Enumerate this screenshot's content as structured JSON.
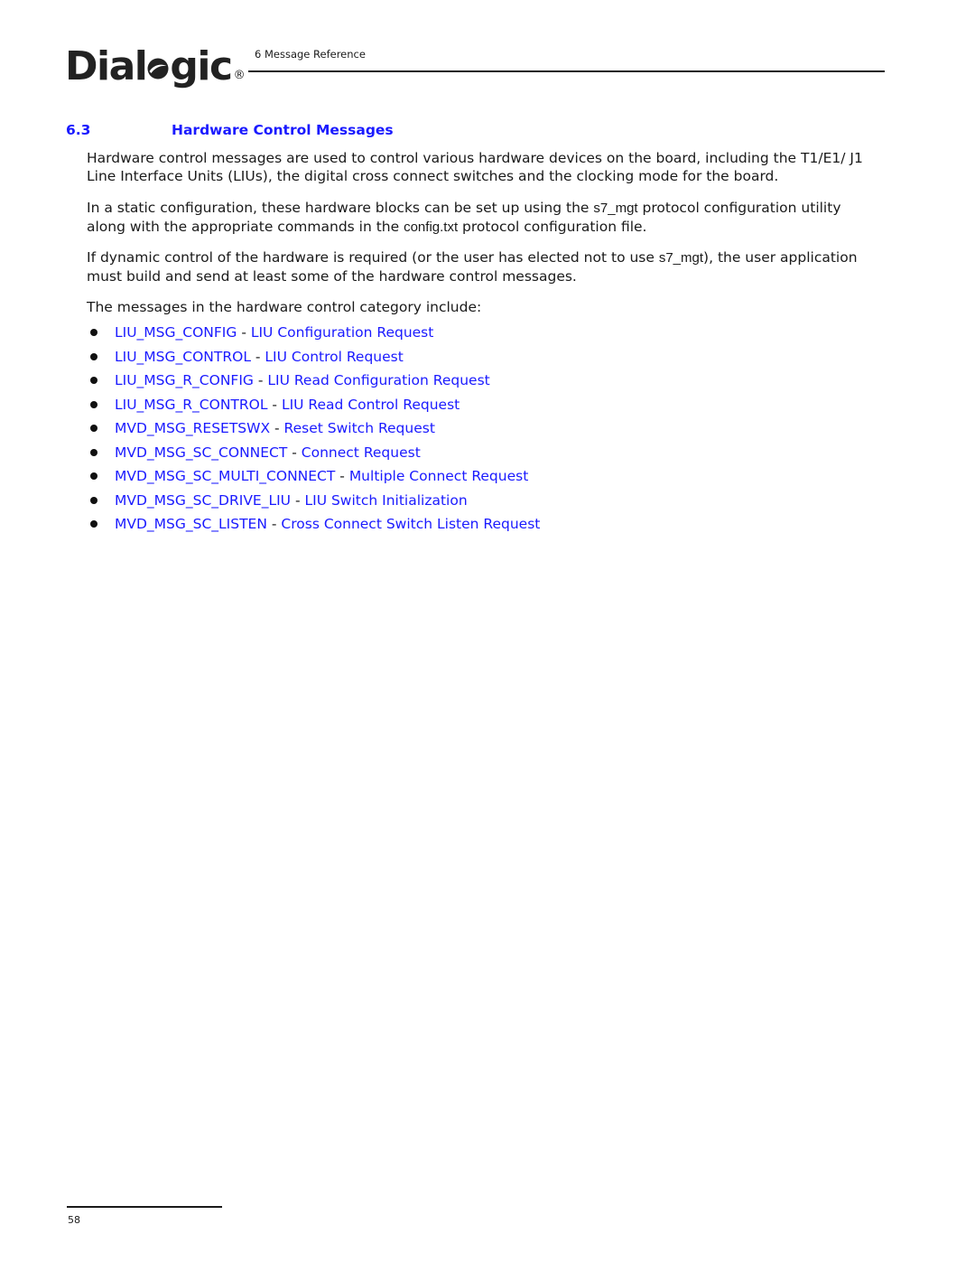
{
  "header": {
    "logo": {
      "text_before_o": "Dial",
      "text_after_o": "gic",
      "registered_mark": "®",
      "brand_color": "#222222"
    },
    "chapter_title": "6 Message Reference"
  },
  "section": {
    "number": "6.3",
    "title": "Hardware Control Messages",
    "heading_color": "#1a1aff"
  },
  "paragraphs": {
    "p1": "Hardware control messages are used to control various hardware devices on the board, including the T1/E1/ J1 Line Interface Units (LIUs), the digital cross connect switches and the clocking mode for the board.",
    "p2": {
      "part1": "In a static configuration, these hardware blocks can be set up using the ",
      "code1": "s7_mgt",
      "part2": " protocol configuration utility along with the appropriate commands in the ",
      "code2": "config.txt",
      "part3": " protocol configuration file."
    },
    "p3": {
      "part1": "If dynamic control of the hardware is required (or the user has elected not to use ",
      "code1": "s7_mgt",
      "part2": "), the user application must build and send at least some of the hardware control messages."
    },
    "p4": "The messages in the hardware control category include:"
  },
  "messages": [
    {
      "name": "LIU_MSG_CONFIG",
      "separator": " - ",
      "description": "LIU Configuration Request"
    },
    {
      "name": "LIU_MSG_CONTROL",
      "separator": " - ",
      "description": "LIU Control Request"
    },
    {
      "name": "LIU_MSG_R_CONFIG",
      "separator": " - ",
      "description": "LIU Read Configuration Request"
    },
    {
      "name": "LIU_MSG_R_CONTROL",
      "separator": " - ",
      "description": "LIU Read Control Request"
    },
    {
      "name": "MVD_MSG_RESETSWX",
      "separator": " - ",
      "description": "Reset Switch Request"
    },
    {
      "name": "MVD_MSG_SC_CONNECT",
      "separator": " - ",
      "description": "Connect Request"
    },
    {
      "name": "MVD_MSG_SC_MULTI_CONNECT",
      "separator": " - ",
      "description": "Multiple Connect Request"
    },
    {
      "name": "MVD_MSG_SC_DRIVE_LIU",
      "separator": " - ",
      "description": "LIU Switch Initialization"
    },
    {
      "name": "MVD_MSG_SC_LISTEN",
      "separator": " - ",
      "description": "Cross Connect Switch Listen Request"
    }
  ],
  "link_color": "#1a1aff",
  "footer": {
    "page_number": "58"
  }
}
